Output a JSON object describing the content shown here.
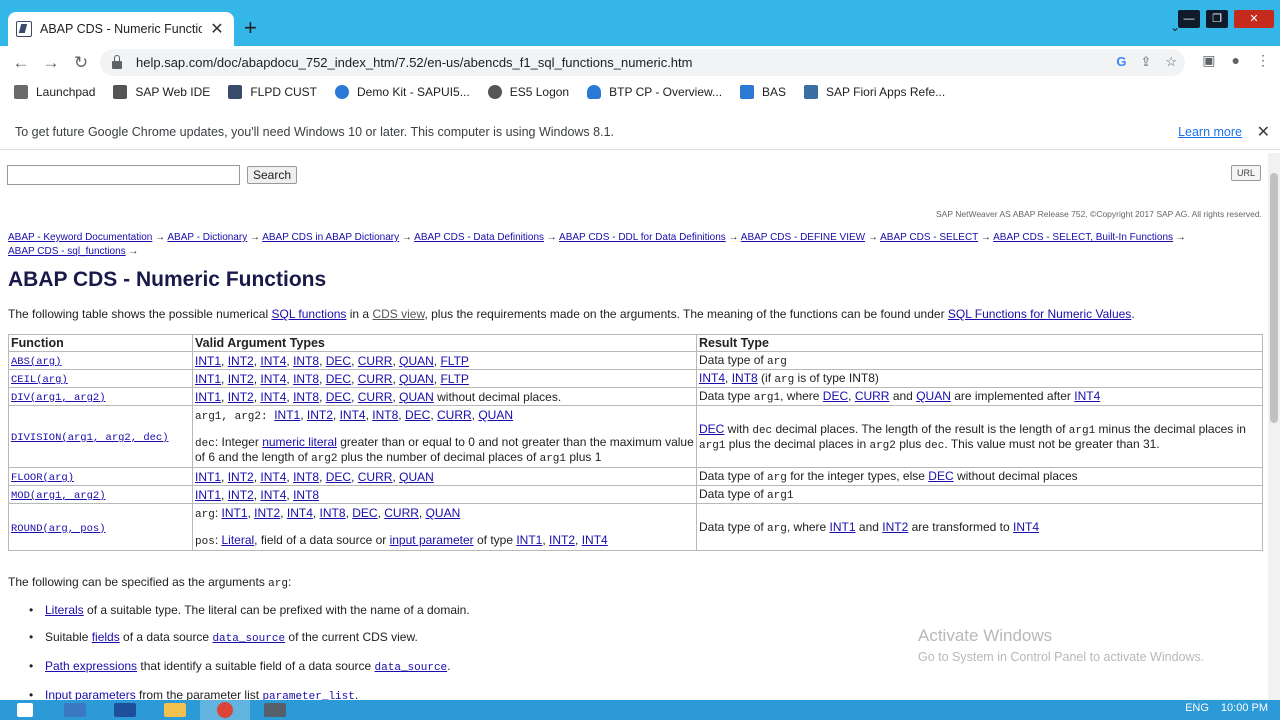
{
  "browser": {
    "tab_title": "ABAP CDS - Numeric Functions",
    "url": "help.sap.com/doc/abapdocu_752_index_htm/7.52/en-us/abencds_f1_sql_functions_numeric.htm"
  },
  "bookmarks": [
    {
      "label": "Launchpad",
      "icon": "launchpad-icon",
      "color": "#6b6b6b"
    },
    {
      "label": "SAP Web IDE",
      "icon": "webide-icon",
      "color": "#555555"
    },
    {
      "label": "FLPD CUST",
      "icon": "flpd-icon",
      "color": "#3a4b6b"
    },
    {
      "label": "Demo Kit - SAPUI5...",
      "icon": "demokit-icon",
      "color": "#2a7ad5"
    },
    {
      "label": "ES5 Logon",
      "icon": "es5-icon",
      "color": "#555555"
    },
    {
      "label": "BTP CP - Overview...",
      "icon": "btp-icon",
      "color": "#2a7ad5"
    },
    {
      "label": "BAS",
      "icon": "bas-icon",
      "color": "#2a7ad5"
    },
    {
      "label": "SAP Fiori Apps Refe...",
      "icon": "fiori-icon",
      "color": "#3a6ea5"
    }
  ],
  "infobar": {
    "message": "To get future Google Chrome updates, you'll need Windows 10 or later. This computer is using Windows 8.1.",
    "link": "Learn more"
  },
  "page": {
    "search_button": "Search",
    "url_button": "URL",
    "copyright": "SAP NetWeaver AS ABAP Release 752, ©Copyright 2017 SAP AG. All rights reserved.",
    "breadcrumb": [
      "ABAP - Keyword Documentation",
      "ABAP - Dictionary",
      "ABAP CDS in ABAP Dictionary",
      "ABAP CDS - Data Definitions",
      "ABAP CDS - DDL for Data Definitions",
      "ABAP CDS - DEFINE VIEW",
      "ABAP CDS - SELECT",
      "ABAP CDS - SELECT, Built-In Functions",
      "ABAP CDS - sql_functions"
    ],
    "title": "ABAP CDS - Numeric Functions",
    "intro": {
      "t1": "The following table shows the possible numerical ",
      "l1": "SQL functions",
      "t2": " in a ",
      "l2": "CDS view",
      "t3": ", plus the requirements made on the arguments. The meaning of the functions can be found under ",
      "l3": "SQL Functions for Numeric Values",
      "t4": "."
    },
    "table": {
      "headers": [
        "Function",
        "Valid Argument Types",
        "Result Type"
      ],
      "fn": [
        "ABS(arg)",
        "CEIL(arg)",
        "DIV(arg1, arg2)",
        "DIVISION(arg1, arg2, dec)",
        "FLOOR(arg)",
        "MOD(arg1, arg2)",
        "ROUND(arg, pos)"
      ],
      "types": {
        "abs": [
          "INT1",
          "INT2",
          "INT4",
          "INT8",
          "DEC",
          "CURR",
          "QUAN",
          "FLTP"
        ],
        "ceil": [
          "INT1",
          "INT2",
          "INT4",
          "INT8",
          "DEC",
          "CURR",
          "QUAN",
          "FLTP"
        ],
        "div": [
          "INT1",
          "INT2",
          "INT4",
          "INT8",
          "DEC",
          "CURR",
          "QUAN"
        ],
        "div_suffix": " without decimal places.",
        "division_prefix": "arg1, arg2: ",
        "division": [
          "INT1",
          "INT2",
          "INT4",
          "INT8",
          "DEC",
          "CURR",
          "QUAN"
        ],
        "division_dec_prefix": "dec",
        "division_dec_t1": ": Integer ",
        "division_dec_link": "numeric literal",
        "division_dec_t2": " greater than or equal to 0 and not greater than the maximum value of 6 and the length of ",
        "division_dec_arg2": "arg2",
        "division_dec_t3": " plus the number of decimal places of ",
        "division_dec_arg1": "arg1",
        "division_dec_t4": " plus 1",
        "floor": [
          "INT1",
          "INT2",
          "INT4",
          "INT8",
          "DEC",
          "CURR",
          "QUAN"
        ],
        "mod": [
          "INT1",
          "INT2",
          "INT4",
          "INT8"
        ],
        "round_prefix": "arg",
        "round": [
          "INT1",
          "INT2",
          "INT4",
          "INT8",
          "DEC",
          "CURR",
          "QUAN"
        ],
        "round_pos_prefix": "pos",
        "round_pos_t1": ": ",
        "round_pos_link1": "Literal",
        "round_pos_t2": ", field of a data source or ",
        "round_pos_link2": "input parameter",
        "round_pos_t3": " of type ",
        "round_pos_types": [
          "INT1",
          "INT2",
          "INT4"
        ]
      },
      "results": {
        "abs_t": "Data type of ",
        "abs_m": "arg",
        "ceil_l1": "INT4",
        "ceil_l2": "INT8",
        "ceil_t1": " (if ",
        "ceil_m": "arg",
        "ceil_t2": " is of type INT8)",
        "div_t1": "Data type ",
        "div_m": "arg1",
        "div_t2": ", where ",
        "div_l1": "DEC",
        "div_l2": "CURR",
        "div_t3": " and ",
        "div_l3": "QUAN",
        "div_t4": " are implemented after ",
        "div_l4": "INT4",
        "division_l1": "DEC",
        "division_t1": " with ",
        "division_m1": "dec",
        "division_t2": " decimal places. The length of the result is the length of ",
        "division_m2": "arg1",
        "division_t3": " minus the decimal places in ",
        "division_m3": "arg1",
        "division_t4": " plus the decimal places in ",
        "division_m4": "arg2",
        "division_t5": " plus ",
        "division_m5": "dec",
        "division_t6": ". This value must not be greater than 31.",
        "floor_t1": "Data type of ",
        "floor_m": "arg",
        "floor_t2": " for the integer types, else ",
        "floor_l": "DEC",
        "floor_t3": " without decimal places",
        "mod_t": "Data type of ",
        "mod_m": "arg1",
        "round_t1": "Data type of ",
        "round_m": "arg",
        "round_t2": ", where ",
        "round_l1": "INT1",
        "round_t3": " and ",
        "round_l2": "INT2",
        "round_t4": " are transformed to ",
        "round_l3": "INT4"
      }
    },
    "args_title_t": "The following can be specified as the arguments ",
    "args_title_m": "arg",
    "args_title_end": ":",
    "args": [
      {
        "link": "Literals",
        "t1": " of a suitable type. The literal can be prefixed with the name of a domain.",
        "m": "",
        "t2": ""
      },
      {
        "pre": "Suitable ",
        "link": "fields",
        "t1": " of a data source ",
        "m": "data_source",
        "t2": " of the current CDS view."
      },
      {
        "link": "Path expressions",
        "t1": " that identify a suitable field of a data source ",
        "m": "data_source",
        "t2": "."
      },
      {
        "link": "Input parameters",
        "t1": " from the parameter list ",
        "m": "parameter_list",
        "t2": "."
      }
    ]
  },
  "watermark": {
    "title": "Activate Windows",
    "subtitle": "Go to System in Control Panel to activate Windows."
  },
  "taskbar": {
    "lang": "ENG",
    "time": "10:00 PM",
    "apps": [
      {
        "icon": "windows-start-icon",
        "color": "#ffffff"
      },
      {
        "icon": "file-explorer-icon",
        "color": "#3b78c2"
      },
      {
        "icon": "powershell-icon",
        "color": "#1e4f9b"
      },
      {
        "icon": "folder-icon",
        "color": "#f2c14e"
      },
      {
        "icon": "chrome-icon",
        "color": "#db4437"
      },
      {
        "icon": "server-manager-icon",
        "color": "#55606b"
      }
    ]
  }
}
